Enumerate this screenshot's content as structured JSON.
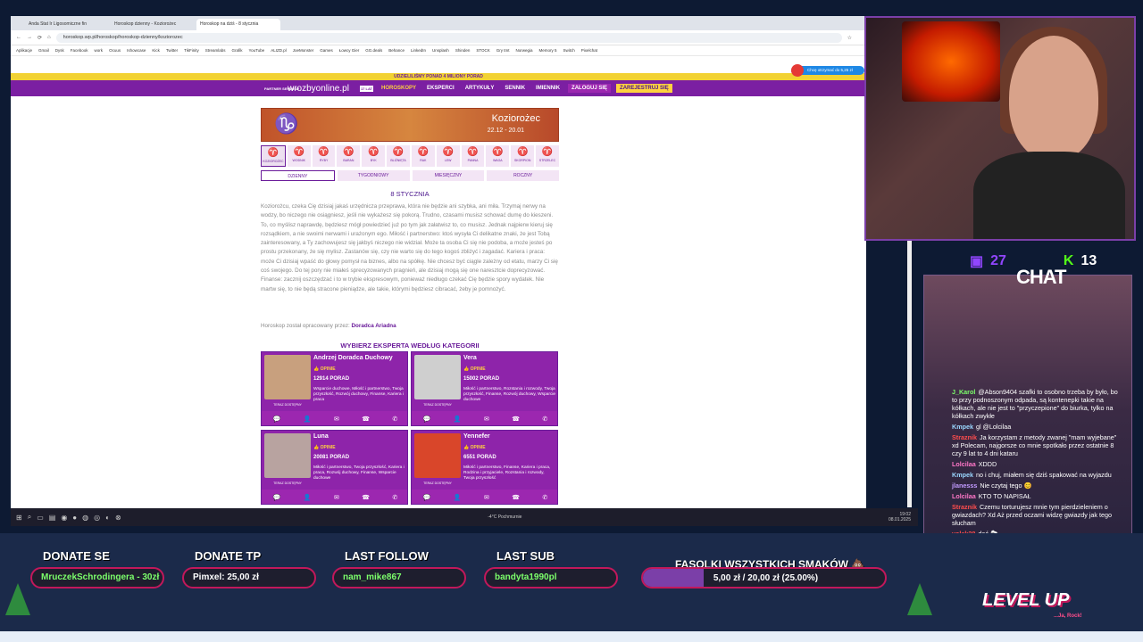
{
  "browser": {
    "tabs": [
      {
        "label": "Anda Stat Ir Ligosomiczne fin",
        "active": false
      },
      {
        "label": "Horoskop dzienny - Koziorożec",
        "active": false
      },
      {
        "label": "Horoskop na dziś - 8 stycznia",
        "active": true
      }
    ],
    "url": "horoskop.wp.pl/horoskop/horoskop-dzienny/koziorozec",
    "bookmarks": [
      "Aplikacje",
      "Gmail",
      "Dysk",
      "Facebook",
      "work",
      "Ocuus",
      "Ishowcase",
      "Kick",
      "Twitter",
      "TikFinity",
      "Streamlabs",
      "Grafik",
      "YouTube",
      "ALIZD.pl",
      "JoeMonster",
      "Games",
      "Łowcy Gier",
      "GG.deals",
      "Behance",
      "LinkedIn",
      "Unsplash",
      "Shinden",
      "STOCK",
      "Gry tmt",
      "Norwegia",
      "Memory 5",
      "Switch",
      "Pixelchat"
    ]
  },
  "site": {
    "promo": "UDZIELILIŚMY PONAD 4 MILIONY PORAD",
    "partner": "PARTNER SERWISU",
    "logo": "wrozbyonline.pl",
    "logo_badge": "17 LAT",
    "nav": [
      "HOROSKOPY",
      "EKSPERCI",
      "ARTYKUŁY",
      "SENNIK",
      "IMIENNIK"
    ],
    "login": "ZALOGUJ SIĘ",
    "register": "ZAREJESTRUJ SIĘ",
    "chat_invite": "Chcę otrzymać do 5,25 zł"
  },
  "horoscope": {
    "sign_name": "Koziorożec",
    "dates": "22.12 - 20.01",
    "signs": [
      "KOZIOROŻEC",
      "WODNIK",
      "RYBY",
      "BARAN",
      "BYK",
      "BLIŹNIĘTA",
      "RAK",
      "LEW",
      "PANNA",
      "WAGA",
      "SKORPION",
      "STRZELEC"
    ],
    "periods": [
      "DZIENNY",
      "TYGODNIOWY",
      "MIESIĘCZNY",
      "ROCZNY"
    ],
    "date": "8 STYCZNIA",
    "text": "Koziorożcu, czeka Cię dzisiaj jakaś urzędnicza przeprawa, która nie będzie ani szybka, ani miła. Trzymaj nerwy na wodzy, bo niczego nie osiągniesz, jeśli nie wykażesz się pokorą. Trudno, czasami musisz schować dumę do kieszeni. To, co myślisz naprawdę, będziesz mógł powiedzieć już po tym jak załatwisz to, co musisz. Jednak najpierw kieruj się rozsądkiem, a nie swoimi nerwami i urażonym ego. Miłość i partnerstwo: ktoś wysyła Ci delikatne znaki, że jest Tobą zainteresowany, a Ty zachowujesz się jakbyś niczego nie widział. Może ta osoba Ci się nie podoba, a może jesteś po prostu przekonany, że się mylisz. Zastanów się, czy nie warto się do tego kogoś zbliżyć i zagadać. Kariera i praca: może Ci dzisiaj wpaść do głowy pomysł na biznes, albo na spółkę. Nie chcesz być ciągle zależny od etatu, marzy Ci się coś swojego. Do tej pory nie miałeś sprecyzowanych pragnień, ale dzisiaj mogą się one naresztcie doprecyzować. Finanse: zacznij oszczędzać i to w trybie ekspresowym, ponieważ niedługo czekać Cię będzie spory wydatek. Nie martw się, to nie będą stracone pieniądze, ale takie, którymi będziesz cibracać, żeby je pomnożyć.",
    "author_label": "Horoskop został opracowany przez:",
    "author": "Doradca Ariadna",
    "experts_title": "WYBIERZ EKSPERTA WEDŁUG KATEGORII"
  },
  "experts": [
    {
      "name": "Andrzej Doradca Duchowy",
      "rating": "OPINIE",
      "count": "12914",
      "count_label": "PORAD",
      "status": "TERAZ DOSTĘPNY",
      "desc": "Wsparcie duchowe, Miłość i partnerstwo, Twoja przyszłość, Rozwój duchowy, Finanse, Kariera i praca"
    },
    {
      "name": "Vera",
      "rating": "OPINIE",
      "count": "15002",
      "count_label": "PORAD",
      "status": "TERAZ DOSTĘPNY",
      "desc": "Miłość i partnerstwo, Rozstania i rozwody, Twoja przyszłość, Finanse, Rozwój duchowy, Wsparcie duchowe"
    },
    {
      "name": "Luna",
      "rating": "OPINIE",
      "count": "20081",
      "count_label": "PORAD",
      "status": "TERAZ DOSTĘPNY",
      "desc": "Miłość i partnerstwo, Twoja przyszłość, Kariera i praca, Rozwój duchowy, Finanse, Wsparcie duchowe"
    },
    {
      "name": "Yennefer",
      "rating": "OPINIE",
      "count": "6551",
      "count_label": "PORAD",
      "status": "TERAZ DOSTĘPNY",
      "desc": "Miłość i partnerstwo, Finanse, Kariera i praca, Rodzina i przyjaciele, Rozstania i rozwody, Twoja przyszłość"
    }
  ],
  "taskbar": {
    "weather": "-4°C Pochmurnie",
    "time": "19:02",
    "date": "08.01.2025"
  },
  "stream": {
    "twitch_count": "27",
    "kick_count": "13",
    "chat_title": "CHAT",
    "chat": [
      {
        "user": "J_Karol",
        "text": "@Abson9404 szafki to osobno trzeba by było, bo to przy podnoszonym odpada, są konteneрki takie na kółkach, ale nie jest to \"przyczepione\" do biurka, tylko na kółkach zwykłe",
        "color": "#7cff6b"
      },
      {
        "user": "Kmpek",
        "text": "gl @Lolcilaa",
        "color": "#9ad7ff"
      },
      {
        "user": "Straznik",
        "text": "Ja korzystam z metody zwanej \"mam wyjebane\" xd Polecam, najgorsze co mnie spotkało przez ostatnie 8 czy 9 lat to 4 dni kataru",
        "color": "#ff4d4d"
      },
      {
        "user": "Lolcilaa",
        "text": "XDDD",
        "color": "#ff77c8"
      },
      {
        "user": "Kmpek",
        "text": "no i chuj, miałem się dziś spakować na wyjazdu",
        "color": "#9ad7ff"
      },
      {
        "user": "jlanesss",
        "text": "Nie czytaj tego 😊",
        "color": "#c29bff"
      },
      {
        "user": "Lolcilaa",
        "text": "KTO TO NAPISAŁ",
        "color": "#ff77c8"
      },
      {
        "user": "Straznik",
        "text": "Czemu torturujesz mnie tym pierdzieleniem o gwiazdach? Xd Aż przed oczami widzę gwiazdy jak tego słucham",
        "color": "#ff4d4d"
      },
      {
        "user": "yolek28",
        "text": "dać 🐑",
        "color": "#ff4d4d"
      }
    ],
    "donate_se_title": "DONATE SE",
    "donate_se_value": "MruczekSchrodingera - 30zł",
    "donate_tp_title": "DONATE TP",
    "donate_tp_value": "Pimxel: 25,00 zł",
    "last_follow_title": "LAST FOLLOW",
    "last_follow_value": "nam_mike867",
    "last_sub_title": "LAST SUB",
    "last_sub_value": "bandyta1990pl",
    "goal_title": "FASOLKI WSZYSTKICH SMAKÓW 💩",
    "goal_value": "5,00 zł / 20,00 zł (25.00%)",
    "goal_fraction": 0.25,
    "brand": "LEVEL UP",
    "brand_sub": "...Ja, Rock!"
  },
  "colors": {
    "accent": "#7b1fa2",
    "twitch": "#9146ff",
    "kick": "#53fc18",
    "panel_border": "#c2185b",
    "donation_text": "#7cff6b"
  }
}
